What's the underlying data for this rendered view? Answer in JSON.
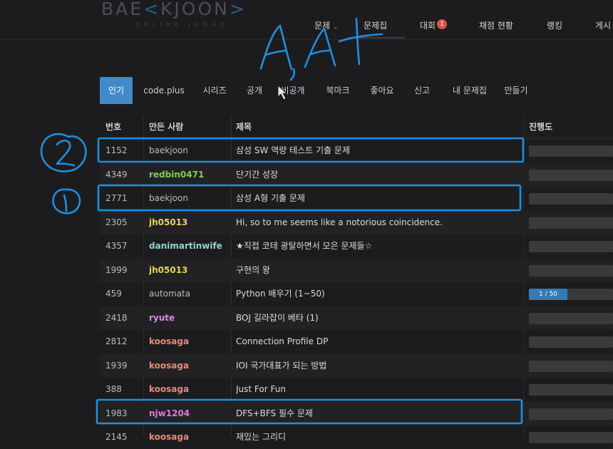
{
  "header": {
    "logo_left": "BAE",
    "logo_mid": "K",
    "logo_right": "JOON",
    "logo_tail": ">",
    "logo_sub": "ONLINE JUDGE",
    "nav": [
      {
        "label": "문제"
      },
      {
        "label": "문제집"
      },
      {
        "label": "대회",
        "badge": "1"
      },
      {
        "label": "채점 현황"
      },
      {
        "label": "랭킹"
      },
      {
        "label": "게시"
      }
    ]
  },
  "tabs": [
    "인기",
    "code.plus",
    "시리즈",
    "공개",
    "비공개",
    "북마크",
    "좋아요",
    "신고",
    "내 문제집",
    "만들기"
  ],
  "table": {
    "headers": [
      "번호",
      "만든 사람",
      "제목",
      "진행도"
    ],
    "rows": [
      {
        "num": "1152",
        "user": "baekjoon",
        "user_color": "#bdbdbd",
        "title": "삼성 SW 역량 테스트 기출 문제"
      },
      {
        "num": "4349",
        "user": "redbin0471",
        "user_color": "#7ccf5a",
        "title": "단기간 성장"
      },
      {
        "num": "2771",
        "user": "baekjoon",
        "user_color": "#bdbdbd",
        "title": "삼성 A형 기출 문제"
      },
      {
        "num": "2305",
        "user": "jh05013",
        "user_color": "#e6d35a",
        "title": "Hi, so to me seems like a notorious coincidence."
      },
      {
        "num": "4357",
        "user": "danimartinwife",
        "user_color": "#8fd6c9",
        "title": "★직접 코테 광탈하면서 모은 문제들☆"
      },
      {
        "num": "1999",
        "user": "jh05013",
        "user_color": "#e6d35a",
        "title": "구현의 왕"
      },
      {
        "num": "459",
        "user": "automata",
        "user_color": "#bdbdbd",
        "title": "Python 배우기 (1~50)",
        "progress_text": "1 / 50",
        "progress": 0.02
      },
      {
        "num": "2418",
        "user": "ryute",
        "user_color": "#d78ae0",
        "title": "BOJ 길라잡이 베타 (1)"
      },
      {
        "num": "2812",
        "user": "koosaga",
        "user_color": "#e58a7c",
        "title": "Connection Profile DP"
      },
      {
        "num": "1939",
        "user": "koosaga",
        "user_color": "#e58a7c",
        "title": "IOI 국가대표가 되는 방법"
      },
      {
        "num": "388",
        "user": "koosaga",
        "user_color": "#e58a7c",
        "title": "Just For Fun"
      },
      {
        "num": "1983",
        "user": "njw1204",
        "user_color": "#e07ad6",
        "title": "DFS+BFS 필수 문제"
      },
      {
        "num": "2145",
        "user": "koosaga",
        "user_color": "#e58a7c",
        "title": "재밌는 그리디"
      }
    ]
  },
  "annotations": {
    "handwriting": "A,A+",
    "mark_two": "②",
    "mark_one": "①",
    "color": "#1e8fe0"
  }
}
